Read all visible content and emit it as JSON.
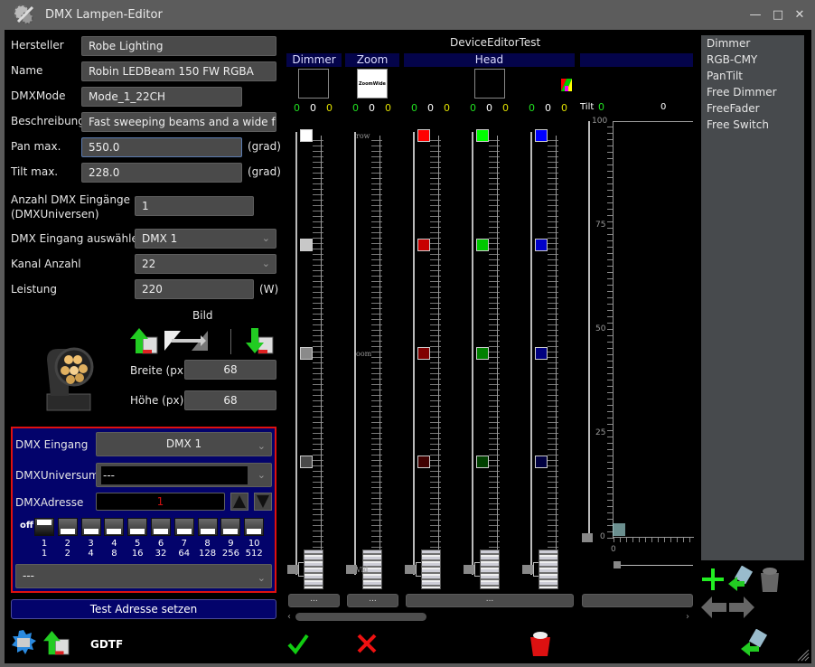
{
  "window": {
    "title": "DMX Lampen-Editor",
    "min_icon": "minimize-icon",
    "max_icon": "maximize-icon",
    "close_icon": "close-icon"
  },
  "form": {
    "hersteller": {
      "label": "Hersteller",
      "value": "Robe Lighting"
    },
    "name": {
      "label": "Name",
      "value": "Robin LEDBeam 150 FW RGBA"
    },
    "dmxmode": {
      "label": "DMXMode",
      "value": "Mode_1_22CH"
    },
    "beschreibung": {
      "label": "Beschreibung",
      "value": "Fast sweeping beams and a wide far-re"
    },
    "pan": {
      "label": "Pan max.",
      "value": "550.0",
      "unit": "(grad)"
    },
    "tilt": {
      "label": "Tilt max.",
      "value": "228.0",
      "unit": "(grad)"
    },
    "eingaenge": {
      "label1": "Anzahl DMX Eingänge",
      "label2": "(DMXUniversen)",
      "value": "1"
    },
    "eingang_select": {
      "label": "DMX Eingang auswählen",
      "value": "DMX 1"
    },
    "kanal": {
      "label": "Kanal Anzahl",
      "value": "22"
    },
    "leistung": {
      "label": "Leistung",
      "value": "220",
      "unit": "(W)"
    }
  },
  "bild": {
    "title": "Bild",
    "breite": {
      "label": "Breite (px)",
      "value": "68"
    },
    "hoehe": {
      "label": "Höhe (px)",
      "value": "68"
    }
  },
  "dmx_panel": {
    "eingang": {
      "label": "DMX Eingang",
      "value": "DMX 1"
    },
    "universum": {
      "label": "DMXUniversum",
      "value": "---"
    },
    "adresse": {
      "label": "DMXAdresse",
      "value": "1"
    },
    "off_label": "off",
    "switches": [
      {
        "n": "1",
        "v": "1",
        "on": true
      },
      {
        "n": "2",
        "v": "2",
        "on": false
      },
      {
        "n": "3",
        "v": "4",
        "on": false
      },
      {
        "n": "4",
        "v": "8",
        "on": false
      },
      {
        "n": "5",
        "v": "16",
        "on": false
      },
      {
        "n": "6",
        "v": "32",
        "on": false
      },
      {
        "n": "7",
        "v": "64",
        "on": false
      },
      {
        "n": "8",
        "v": "128",
        "on": false
      },
      {
        "n": "9",
        "v": "256",
        "on": false
      },
      {
        "n": "10",
        "v": "512",
        "on": false
      }
    ],
    "bottom_select": "---"
  },
  "test_button": "Test Adresse setzen",
  "gdtf_label": "GDTF",
  "device": {
    "title": "DeviceEditorTest",
    "groups": [
      "Dimmer",
      "Zoom",
      "Head",
      ""
    ],
    "zoom_preview_text": "ZoomWide",
    "values": [
      [
        "0",
        "0",
        "0"
      ],
      [
        "0",
        "0",
        "0"
      ],
      [
        "0",
        "0",
        "0"
      ],
      [
        "0",
        "0",
        "0"
      ],
      [
        "0",
        "0",
        "0"
      ]
    ],
    "tilt_label": "Tilt",
    "tilt_value": "0",
    "pan_value": "0",
    "zoom_fader_top": "row",
    "zoom_fader_mid": "oom",
    "zoom_fader_bottom": "Vid",
    "fader_colors": [
      [
        "#ffffff",
        "#c8c8c8",
        "#8a8a8a",
        "#4a4a4a"
      ],
      [],
      [
        "#ff0000",
        "#c80000",
        "#800000",
        "#400000"
      ],
      [
        "#00ff00",
        "#00c800",
        "#008000",
        "#004000"
      ],
      [
        "#0000ff",
        "#0000c8",
        "#000080",
        "#000040"
      ]
    ],
    "fader_values": [
      0,
      0,
      0,
      0,
      0
    ],
    "slot_buttons": [
      "...",
      "...",
      "...",
      ""
    ]
  },
  "xy_pad": {
    "y_ticks": [
      "100",
      "75",
      "50",
      "25",
      "0"
    ],
    "x_tick": "0"
  },
  "feature_list": [
    "Dimmer",
    "RGB-CMY",
    "PanTilt",
    "Free Dimmer",
    "FreeFader",
    "Free Switch"
  ],
  "colors": {
    "accent_red": "#e01010",
    "panel_blue": "#03036b",
    "value_green": "#21e021",
    "value_yellow": "#e0e000"
  }
}
